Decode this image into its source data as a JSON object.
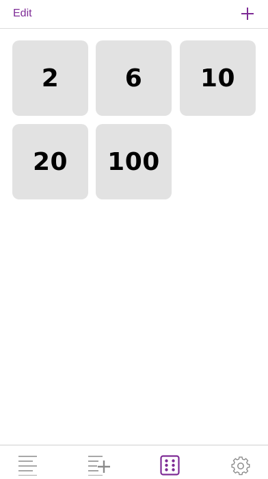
{
  "nav": {
    "edit_label": "Edit",
    "add_icon": "plus-icon"
  },
  "dice": [
    {
      "label": "2"
    },
    {
      "label": "6"
    },
    {
      "label": "10"
    },
    {
      "label": "20"
    },
    {
      "label": "100"
    }
  ],
  "tabs": [
    {
      "icon": "list-icon",
      "active": false
    },
    {
      "icon": "add-to-list-icon",
      "active": false
    },
    {
      "icon": "dice-icon",
      "active": true
    },
    {
      "icon": "gear-icon",
      "active": false
    }
  ],
  "colors": {
    "accent": "#7d2a95",
    "inactive_icon": "#8a8a8a",
    "tile_bg": "#e2e2e2"
  }
}
